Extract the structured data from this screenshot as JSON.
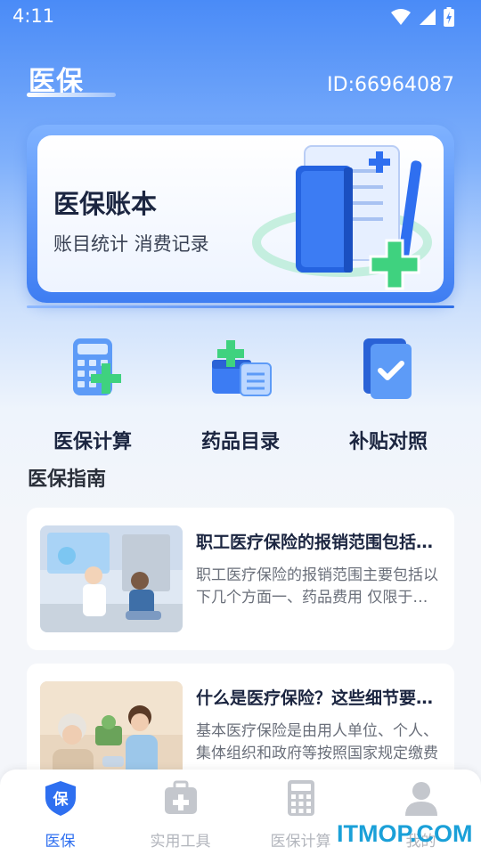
{
  "status_bar": {
    "time": "4:11"
  },
  "header": {
    "title": "医保",
    "user_id": "ID:66964087"
  },
  "banner": {
    "title": "医保账本",
    "subtitle": "账目统计 消费记录"
  },
  "quick_actions": [
    {
      "label": "医保计算",
      "icon": "calculator-icon"
    },
    {
      "label": "药品目录",
      "icon": "medicine-box-icon"
    },
    {
      "label": "补贴对照",
      "icon": "checklist-folder-icon"
    }
  ],
  "guide": {
    "title": "医保指南",
    "articles": [
      {
        "title": "职工医疗保险的报销范围包括哪些",
        "desc": "职工医疗保险的报销范围主要包括以下几个方面一、药品费用 仅限于医保目录内药品"
      },
      {
        "title": "什么是医疗保险？这些细节要了解",
        "desc": "基本医疗保险是由用人单位、个人、集体组织和政府等按照国家规定缴费"
      }
    ]
  },
  "bottom_nav": [
    {
      "label": "医保",
      "active": true
    },
    {
      "label": "实用工具",
      "active": false
    },
    {
      "label": "医保计算",
      "active": false
    },
    {
      "label": "我的",
      "active": false
    }
  ],
  "watermark": "ITMOP.COM",
  "colors": {
    "primary": "#2e6ff0",
    "accent_green": "#3fd27f",
    "inactive": "#b3b6bd"
  }
}
